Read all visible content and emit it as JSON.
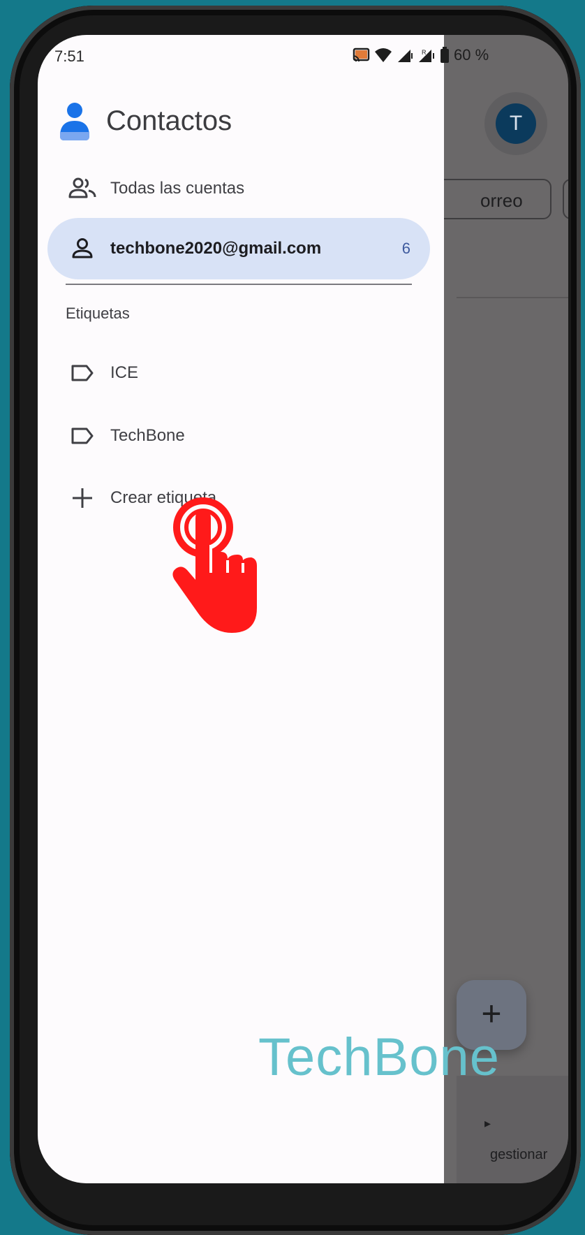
{
  "status_bar": {
    "time": "7:51",
    "battery": "60 %"
  },
  "background": {
    "avatar_letter": "T",
    "chip_text": "orreo",
    "fab_symbol": "+",
    "bottom_label": "gestionar"
  },
  "drawer": {
    "app_title": "Contactos",
    "accounts": [
      {
        "label": "Todas las cuentas",
        "icon": "group-icon"
      },
      {
        "label": "techbone2020@gmail.com",
        "icon": "person-icon",
        "count": "6",
        "selected": true
      }
    ],
    "section_label": "Etiquetas",
    "labels": [
      {
        "label": "ICE",
        "icon": "label-icon"
      },
      {
        "label": "TechBone",
        "icon": "label-icon"
      },
      {
        "label": "Crear etiqueta",
        "icon": "plus-icon"
      }
    ]
  },
  "watermark": "TechBone",
  "colors": {
    "selected_bg": "#d8e2f6",
    "accent": "#1a73e8",
    "hand": "#ff1a1a"
  }
}
